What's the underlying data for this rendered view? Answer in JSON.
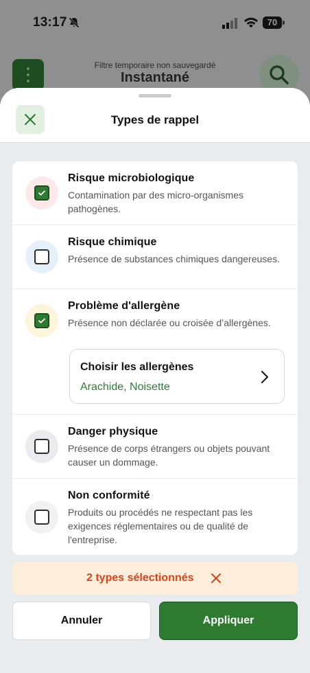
{
  "status_bar": {
    "time": "13:17",
    "battery": "70"
  },
  "background": {
    "subtitle": "Filtre temporaire non sauvegardé",
    "title": "Instantané"
  },
  "sheet": {
    "title": "Types de rappel",
    "items": [
      {
        "title": "Risque microbiologique",
        "description": "Contamination par des micro-organismes pathogènes.",
        "checked": true,
        "circle_color": "#fde9e9"
      },
      {
        "title": "Risque chimique",
        "description": "Présence de substances chimiques dangereuses.",
        "checked": false,
        "circle_color": "#e6f0fb"
      },
      {
        "title": "Problème d'allergène",
        "description": "Présence non déclarée ou croisée d’allergènes.",
        "checked": true,
        "circle_color": "#fdf4dc"
      },
      {
        "title": "Danger physique",
        "description": "Présence de corps étrangers ou objets pouvant causer un dommage.",
        "checked": false,
        "circle_color": "#eaebee"
      },
      {
        "title": "Non conformité",
        "description": "Produits ou procédés ne respectant pas les exigences réglementaires ou de qualité de l'entreprise.",
        "checked": false,
        "circle_color": "#f0f1f3"
      }
    ],
    "allergen_picker": {
      "label": "Choisir les allergènes",
      "value": "Arachide, Noisette"
    },
    "summary": {
      "text": "2 types sélectionnés"
    },
    "buttons": {
      "cancel": "Annuler",
      "apply": "Appliquer"
    }
  },
  "colors": {
    "accent_green": "#2e7a31",
    "summary_red": "#d6451c",
    "summary_bg": "#fdeedb"
  }
}
